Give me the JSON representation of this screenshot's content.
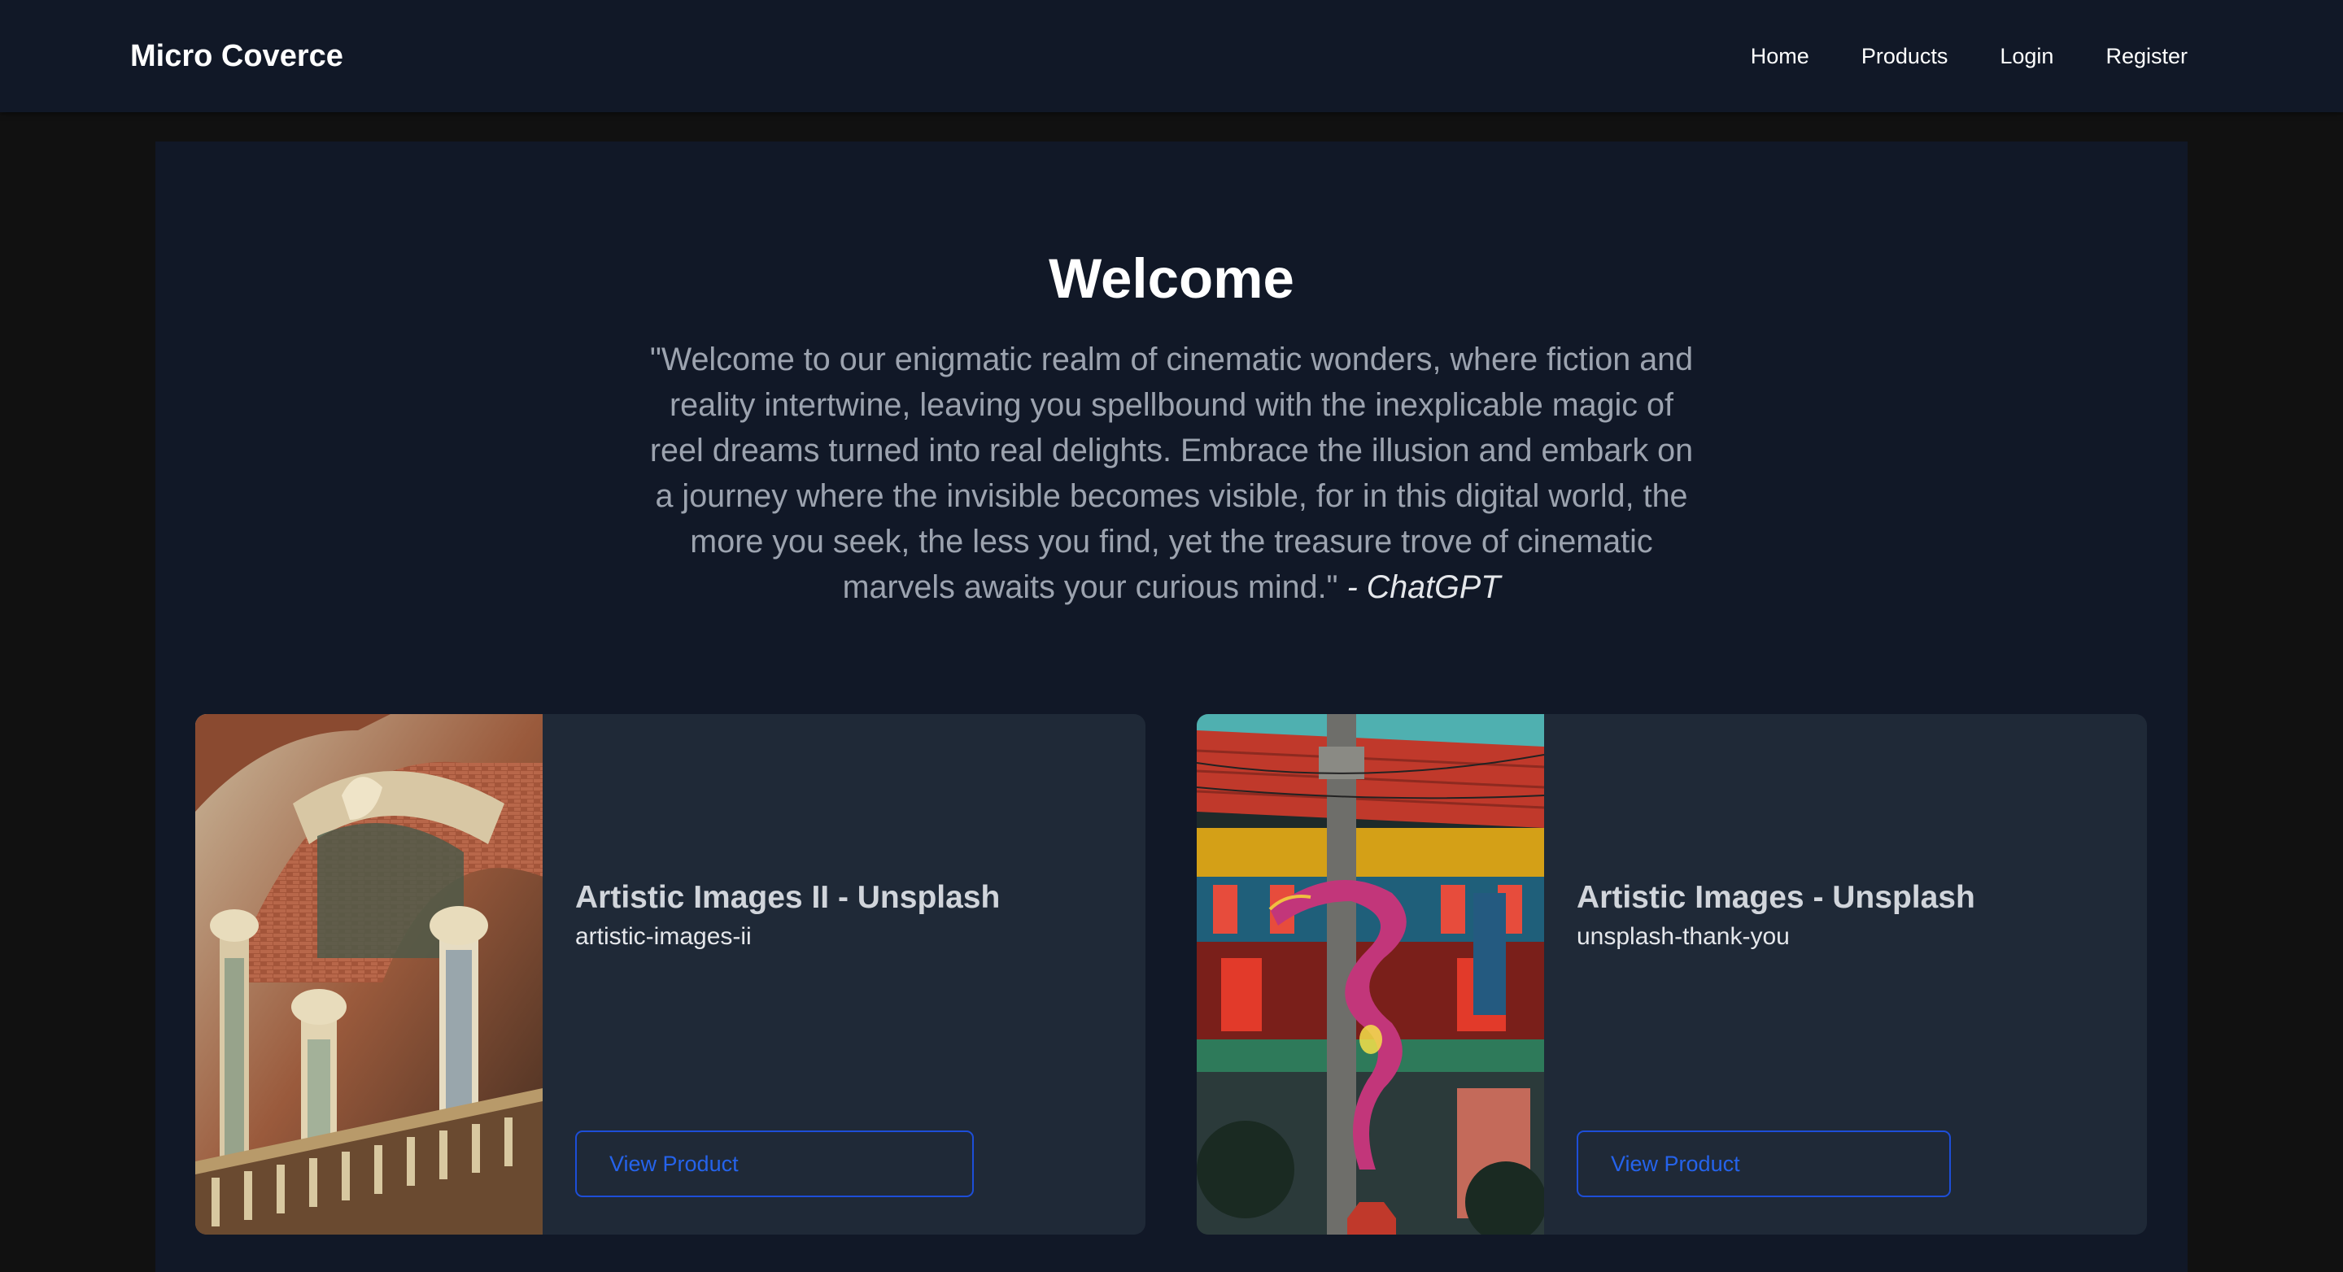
{
  "header": {
    "brand": "Micro Coverce",
    "nav": [
      {
        "label": "Home"
      },
      {
        "label": "Products"
      },
      {
        "label": "Login"
      },
      {
        "label": "Register"
      }
    ]
  },
  "hero": {
    "title": "Welcome",
    "quote": "\"Welcome to our enigmatic realm of cinematic wonders, where fiction and reality intertwine, leaving you spellbound with the inexplicable magic of reel dreams turned into real delights. Embrace the illusion and embark on a journey where the invisible becomes visible, for in this digital world, the more you seek, the less you find, yet the treasure trove of cinematic marvels awaits your curious mind.\"",
    "author": "- ChatGPT"
  },
  "products": [
    {
      "title": "Artistic Images II - Unsplash",
      "slug": "artistic-images-ii",
      "button": "View Product",
      "image": "ornate-architecture-photo"
    },
    {
      "title": "Artistic Images - Unsplash",
      "slug": "unsplash-thank-you",
      "button": "View Product",
      "image": "dragon-pole-street-photo"
    }
  ],
  "colors": {
    "page_bg": "#111111",
    "panel_bg": "#111827",
    "card_bg": "#1f2937",
    "accent": "#2563eb",
    "muted_text": "#9ca3af"
  }
}
